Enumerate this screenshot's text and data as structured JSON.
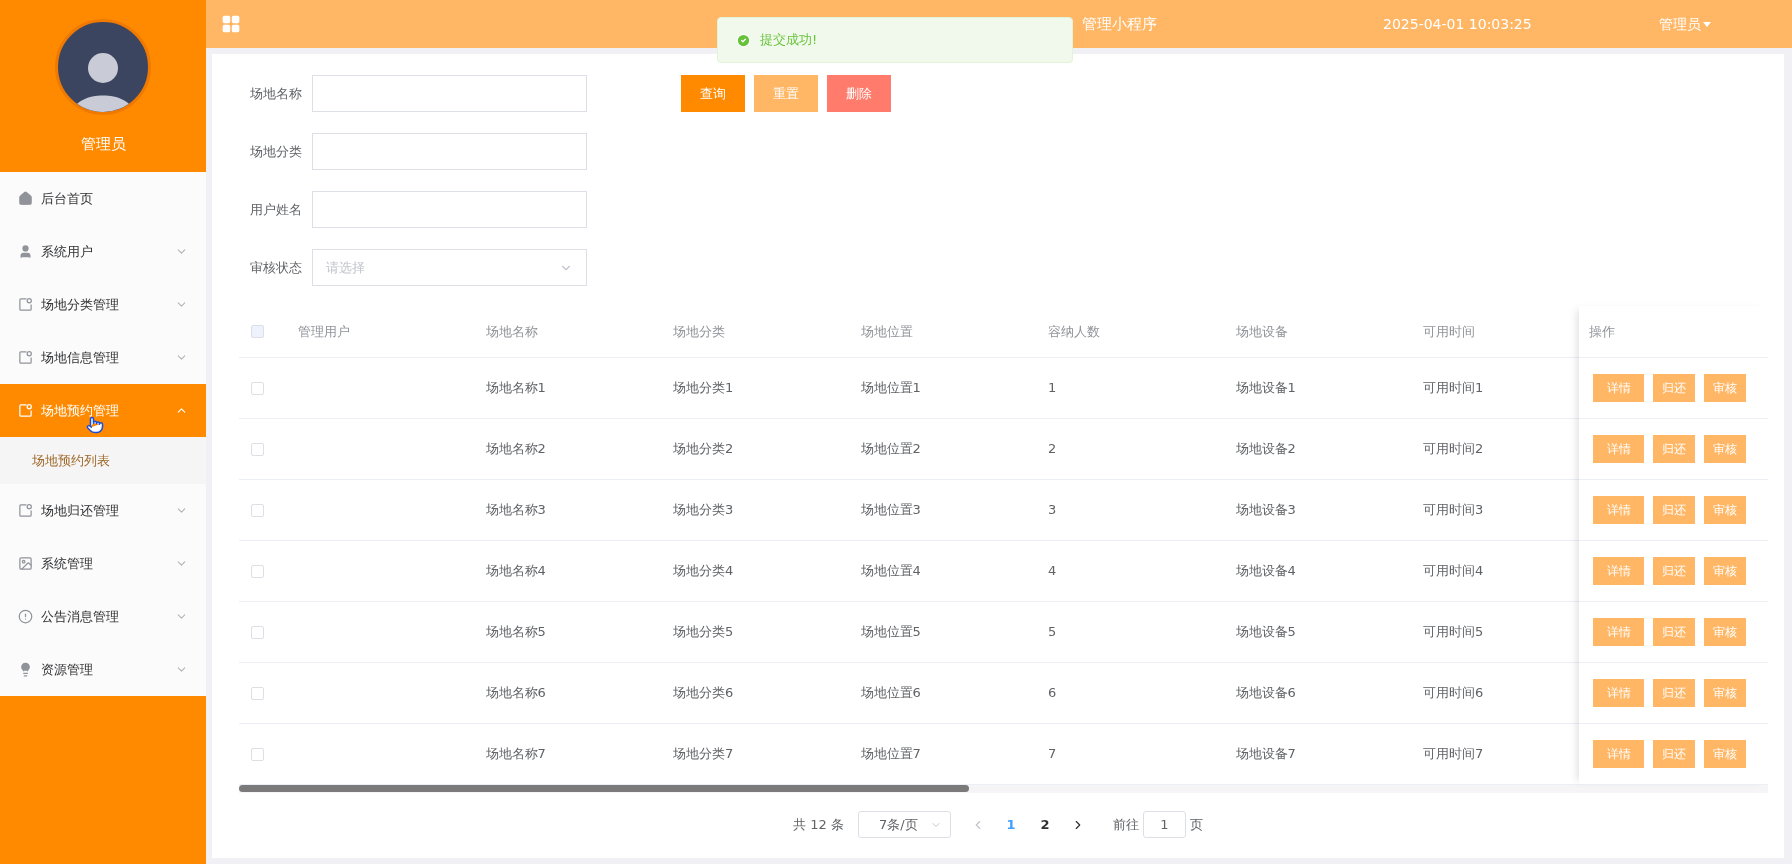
{
  "sidebar": {
    "user_name": "管理员",
    "items": [
      {
        "label": "后台首页",
        "selected": false
      },
      {
        "label": "系统用户",
        "selected": false,
        "expanded": false
      },
      {
        "label": "场地分类管理",
        "selected": false,
        "expanded": false
      },
      {
        "label": "场地信息管理",
        "selected": false,
        "expanded": false
      },
      {
        "label": "场地预约管理",
        "selected": true,
        "expanded": true,
        "children": [
          {
            "label": "场地预约列表",
            "selected": true
          }
        ]
      },
      {
        "label": "场地归还管理",
        "selected": false,
        "expanded": false
      },
      {
        "label": "系统管理",
        "selected": false,
        "expanded": false
      },
      {
        "label": "公告消息管理",
        "selected": false,
        "expanded": false
      },
      {
        "label": "资源管理",
        "selected": false,
        "expanded": false
      }
    ]
  },
  "header": {
    "title": "管理小程序",
    "datetime": "2025-04-01 10:03:25",
    "user": "管理员"
  },
  "toast": {
    "message": "提交成功!"
  },
  "filters": [
    {
      "label": "场地名称",
      "kind": "input"
    },
    {
      "label": "场地分类",
      "kind": "input"
    },
    {
      "label": "用户姓名",
      "kind": "input"
    },
    {
      "label": "审核状态",
      "kind": "select",
      "placeholder": "请选择"
    }
  ],
  "filter_buttons": [
    {
      "label": "查询",
      "kind": "primary"
    },
    {
      "label": "重置",
      "kind": "reset"
    },
    {
      "label": "删除",
      "kind": "danger"
    }
  ],
  "table": {
    "all_checked": false,
    "columns": [
      "管理用户",
      "场地名称",
      "场地分类",
      "场地位置",
      "容纳人数",
      "场地设备",
      "可用时间"
    ],
    "action_column": "操作",
    "rows": [
      {
        "checked": false,
        "cells": [
          "",
          "场地名称1",
          "场地分类1",
          "场地位置1",
          "1",
          "场地设备1",
          "可用时间1"
        ],
        "actions": [
          "详情",
          "归还",
          "审核"
        ]
      },
      {
        "checked": false,
        "cells": [
          "",
          "场地名称2",
          "场地分类2",
          "场地位置2",
          "2",
          "场地设备2",
          "可用时间2"
        ],
        "actions": [
          "详情",
          "归还",
          "审核"
        ]
      },
      {
        "checked": false,
        "cells": [
          "",
          "场地名称3",
          "场地分类3",
          "场地位置3",
          "3",
          "场地设备3",
          "可用时间3"
        ],
        "actions": [
          "详情",
          "归还",
          "审核"
        ]
      },
      {
        "checked": false,
        "cells": [
          "",
          "场地名称4",
          "场地分类4",
          "场地位置4",
          "4",
          "场地设备4",
          "可用时间4"
        ],
        "actions": [
          "详情",
          "归还",
          "审核"
        ]
      },
      {
        "checked": false,
        "cells": [
          "",
          "场地名称5",
          "场地分类5",
          "场地位置5",
          "5",
          "场地设备5",
          "可用时间5"
        ],
        "actions": [
          "详情",
          "归还",
          "审核"
        ]
      },
      {
        "checked": false,
        "cells": [
          "",
          "场地名称6",
          "场地分类6",
          "场地位置6",
          "6",
          "场地设备6",
          "可用时间6"
        ],
        "actions": [
          "详情",
          "归还",
          "审核"
        ]
      },
      {
        "checked": false,
        "cells": [
          "",
          "场地名称7",
          "场地分类7",
          "场地位置7",
          "7",
          "场地设备7",
          "可用时间7"
        ],
        "actions": [
          "详情",
          "归还",
          "审核"
        ]
      }
    ]
  },
  "pagination": {
    "total": "共 12 条",
    "page_size": "7条/页",
    "pages": [
      {
        "label": "1",
        "selected": true
      },
      {
        "label": "2",
        "selected": false
      }
    ],
    "goto_label": "前往",
    "goto_value": "1",
    "goto_suffix": "页"
  }
}
